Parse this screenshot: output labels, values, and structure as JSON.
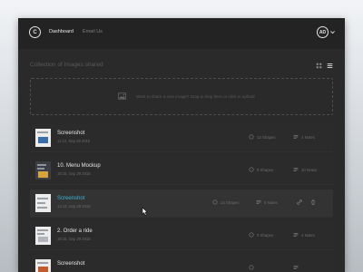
{
  "header": {
    "logo_letter": "C",
    "nav": [
      "Dashboard",
      "Email Us"
    ],
    "avatar_initials": "AD"
  },
  "main": {
    "section_title": "Collection of Images shared",
    "dropzone_text": "Want to share a new image? Drag & drop here or click to upload"
  },
  "rows": [
    {
      "title": "Screenshot",
      "date": "11:12, Sep 28 2015",
      "shapes": "12 Shapes",
      "notes": "4 Notes"
    },
    {
      "title": "10. Menu Mockup",
      "date": "18:15, Sep 29 2015",
      "shapes": "8 Shapes",
      "notes": "10 Notes"
    },
    {
      "title": "Screenshot",
      "date": "12:13, Sep 28 2015",
      "shapes": "14 Shapes",
      "notes": "5 Notes"
    },
    {
      "title": "2. Order a ride",
      "date": "18:15, Sep 29 2015",
      "shapes": "0 Shapes",
      "notes": "4 Notes"
    },
    {
      "title": "Screenshot",
      "date": "",
      "shapes": "",
      "notes": ""
    }
  ],
  "colors": {
    "accent": "#3cb4d8",
    "panel": "#2a2a2a",
    "header": "#232323"
  }
}
